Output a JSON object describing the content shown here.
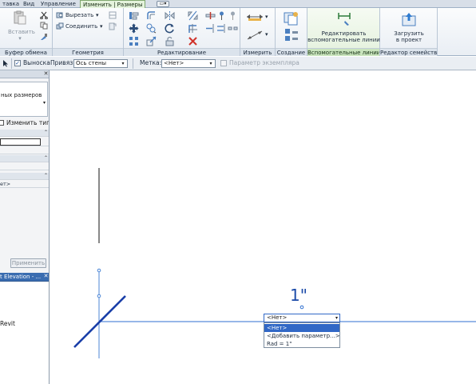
{
  "tabs": {
    "items": [
      "тавка",
      "Вид",
      "Управление",
      "Изменить | Размеры"
    ],
    "active_index": 3
  },
  "ribbon": {
    "clipboard": {
      "paste_label": "Вставить",
      "title": "Буфер обмена"
    },
    "geometry": {
      "cut_label": "Вырезать",
      "join_label": "Соединить",
      "title": "Геометрия"
    },
    "modify": {
      "title": "Редактирование"
    },
    "measure": {
      "title": "Измерить"
    },
    "create": {
      "title": "Создание"
    },
    "ref_lines": {
      "edit_label_line1": "Редактировать",
      "edit_label_line2": "вспомогательные линии",
      "title": "Вспомогательные линии"
    },
    "family_editor": {
      "load_label_line1": "Загрузить",
      "load_label_line2": "в проект",
      "title": "Редактор семейств"
    }
  },
  "options_bar": {
    "leader_label": "Выноска",
    "leader_checked": true,
    "snap_label": "Привязка:",
    "snap_value": "Ось стены",
    "label_label": "Метка:",
    "label_value": "<Нет>",
    "instance_param_label": "Параметр экземпляра",
    "instance_param_checked": false
  },
  "properties": {
    "type_name_fragment": "ных размеров",
    "edit_type_label": "Изменить тип",
    "value_fragment": "ет>",
    "apply_label": "Применить"
  },
  "browser": {
    "title_fragment": "t Elevation - ...",
    "item_fragment": "Revit"
  },
  "canvas": {
    "dimension_text": "1\"",
    "label_dropdown": {
      "current_value": "<Нет>",
      "options": [
        "<Нет>",
        "<Добавить параметр...>",
        "Rad = 1\""
      ],
      "selected_index": 0
    }
  },
  "colors": {
    "annotation_blue": "#1a4aa8",
    "dim_line_blue": "#2f6fd0",
    "selection_blue": "#3168c6",
    "contextual_tab_green": "#e4f3dc"
  }
}
